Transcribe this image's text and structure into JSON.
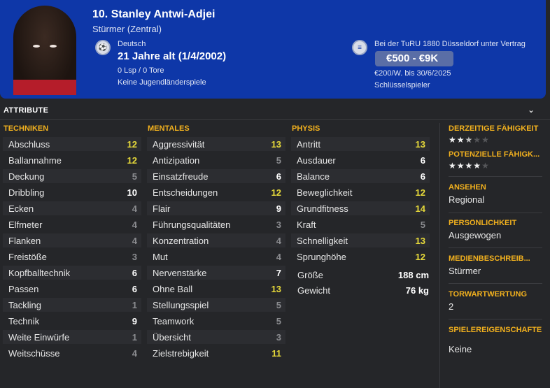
{
  "header": {
    "name": "10. Stanley Antwi-Adjei",
    "position": "Stürmer (Zentral)",
    "nationality": "Deutsch",
    "age": "21 Jahre alt (1/4/2002)",
    "caps": "0 Lsp / 0 Tore",
    "youth": "Keine Jugendländerspiele",
    "club": "Bei der TuRU 1880 Düsseldorf unter Vertrag",
    "value": "€500 - €9K",
    "wage": "€200/W. bis 30/6/2025",
    "role": "Schlüsselspieler"
  },
  "section": {
    "title": "ATTRIBUTE"
  },
  "techniken": {
    "title": "TECHNIKEN",
    "rows": [
      {
        "label": "Abschluss",
        "value": "12"
      },
      {
        "label": "Ballannahme",
        "value": "12"
      },
      {
        "label": "Deckung",
        "value": "5"
      },
      {
        "label": "Dribbling",
        "value": "10"
      },
      {
        "label": "Ecken",
        "value": "4"
      },
      {
        "label": "Elfmeter",
        "value": "4"
      },
      {
        "label": "Flanken",
        "value": "4"
      },
      {
        "label": "Freistöße",
        "value": "3"
      },
      {
        "label": "Kopfballtechnik",
        "value": "6"
      },
      {
        "label": "Passen",
        "value": "6"
      },
      {
        "label": "Tackling",
        "value": "1"
      },
      {
        "label": "Technik",
        "value": "9"
      },
      {
        "label": "Weite Einwürfe",
        "value": "1"
      },
      {
        "label": "Weitschüsse",
        "value": "4"
      }
    ]
  },
  "mentales": {
    "title": "MENTALES",
    "rows": [
      {
        "label": "Aggressivität",
        "value": "13"
      },
      {
        "label": "Antizipation",
        "value": "5"
      },
      {
        "label": "Einsatzfreude",
        "value": "6"
      },
      {
        "label": "Entscheidungen",
        "value": "12"
      },
      {
        "label": "Flair",
        "value": "9"
      },
      {
        "label": "Führungsqualitäten",
        "value": "3"
      },
      {
        "label": "Konzentration",
        "value": "4"
      },
      {
        "label": "Mut",
        "value": "4"
      },
      {
        "label": "Nervenstärke",
        "value": "7"
      },
      {
        "label": "Ohne Ball",
        "value": "13"
      },
      {
        "label": "Stellungsspiel",
        "value": "5"
      },
      {
        "label": "Teamwork",
        "value": "5"
      },
      {
        "label": "Übersicht",
        "value": "3"
      },
      {
        "label": "Zielstrebigkeit",
        "value": "11"
      }
    ]
  },
  "physis": {
    "title": "PHYSIS",
    "rows": [
      {
        "label": "Antritt",
        "value": "13"
      },
      {
        "label": "Ausdauer",
        "value": "6"
      },
      {
        "label": "Balance",
        "value": "6"
      },
      {
        "label": "Beweglichkeit",
        "value": "12"
      },
      {
        "label": "Grundfitness",
        "value": "14"
      },
      {
        "label": "Kraft",
        "value": "5"
      },
      {
        "label": "Schnelligkeit",
        "value": "13"
      },
      {
        "label": "Sprunghöhe",
        "value": "12"
      }
    ],
    "height_label": "Größe",
    "height_value": "188 cm",
    "weight_label": "Gewicht",
    "weight_value": "76 kg"
  },
  "side": {
    "current_ability": {
      "title": "DERZEITIGE FÄHIGKEIT",
      "stars": 2.5
    },
    "potential_ability": {
      "title": "POTENZIELLE FÄHIGK...",
      "stars": 4
    },
    "reputation": {
      "title": "ANSEHEN",
      "value": "Regional"
    },
    "personality": {
      "title": "PERSÖNLICHKEIT",
      "value": "Ausgewogen"
    },
    "media": {
      "title": "MEDIENBESCHREIB...",
      "value": "Stürmer"
    },
    "gk_rating": {
      "title": "TORWARTWERTUNG",
      "value": "2"
    },
    "traits": {
      "title": "SPIELEREIGENSCHAFTEN",
      "value": "Keine"
    }
  },
  "colors": {
    "header": "#0e37a8",
    "accent": "#f2b11e",
    "high": "#e6d93a",
    "mid": "#ffffff",
    "low": "#8b8c90"
  }
}
